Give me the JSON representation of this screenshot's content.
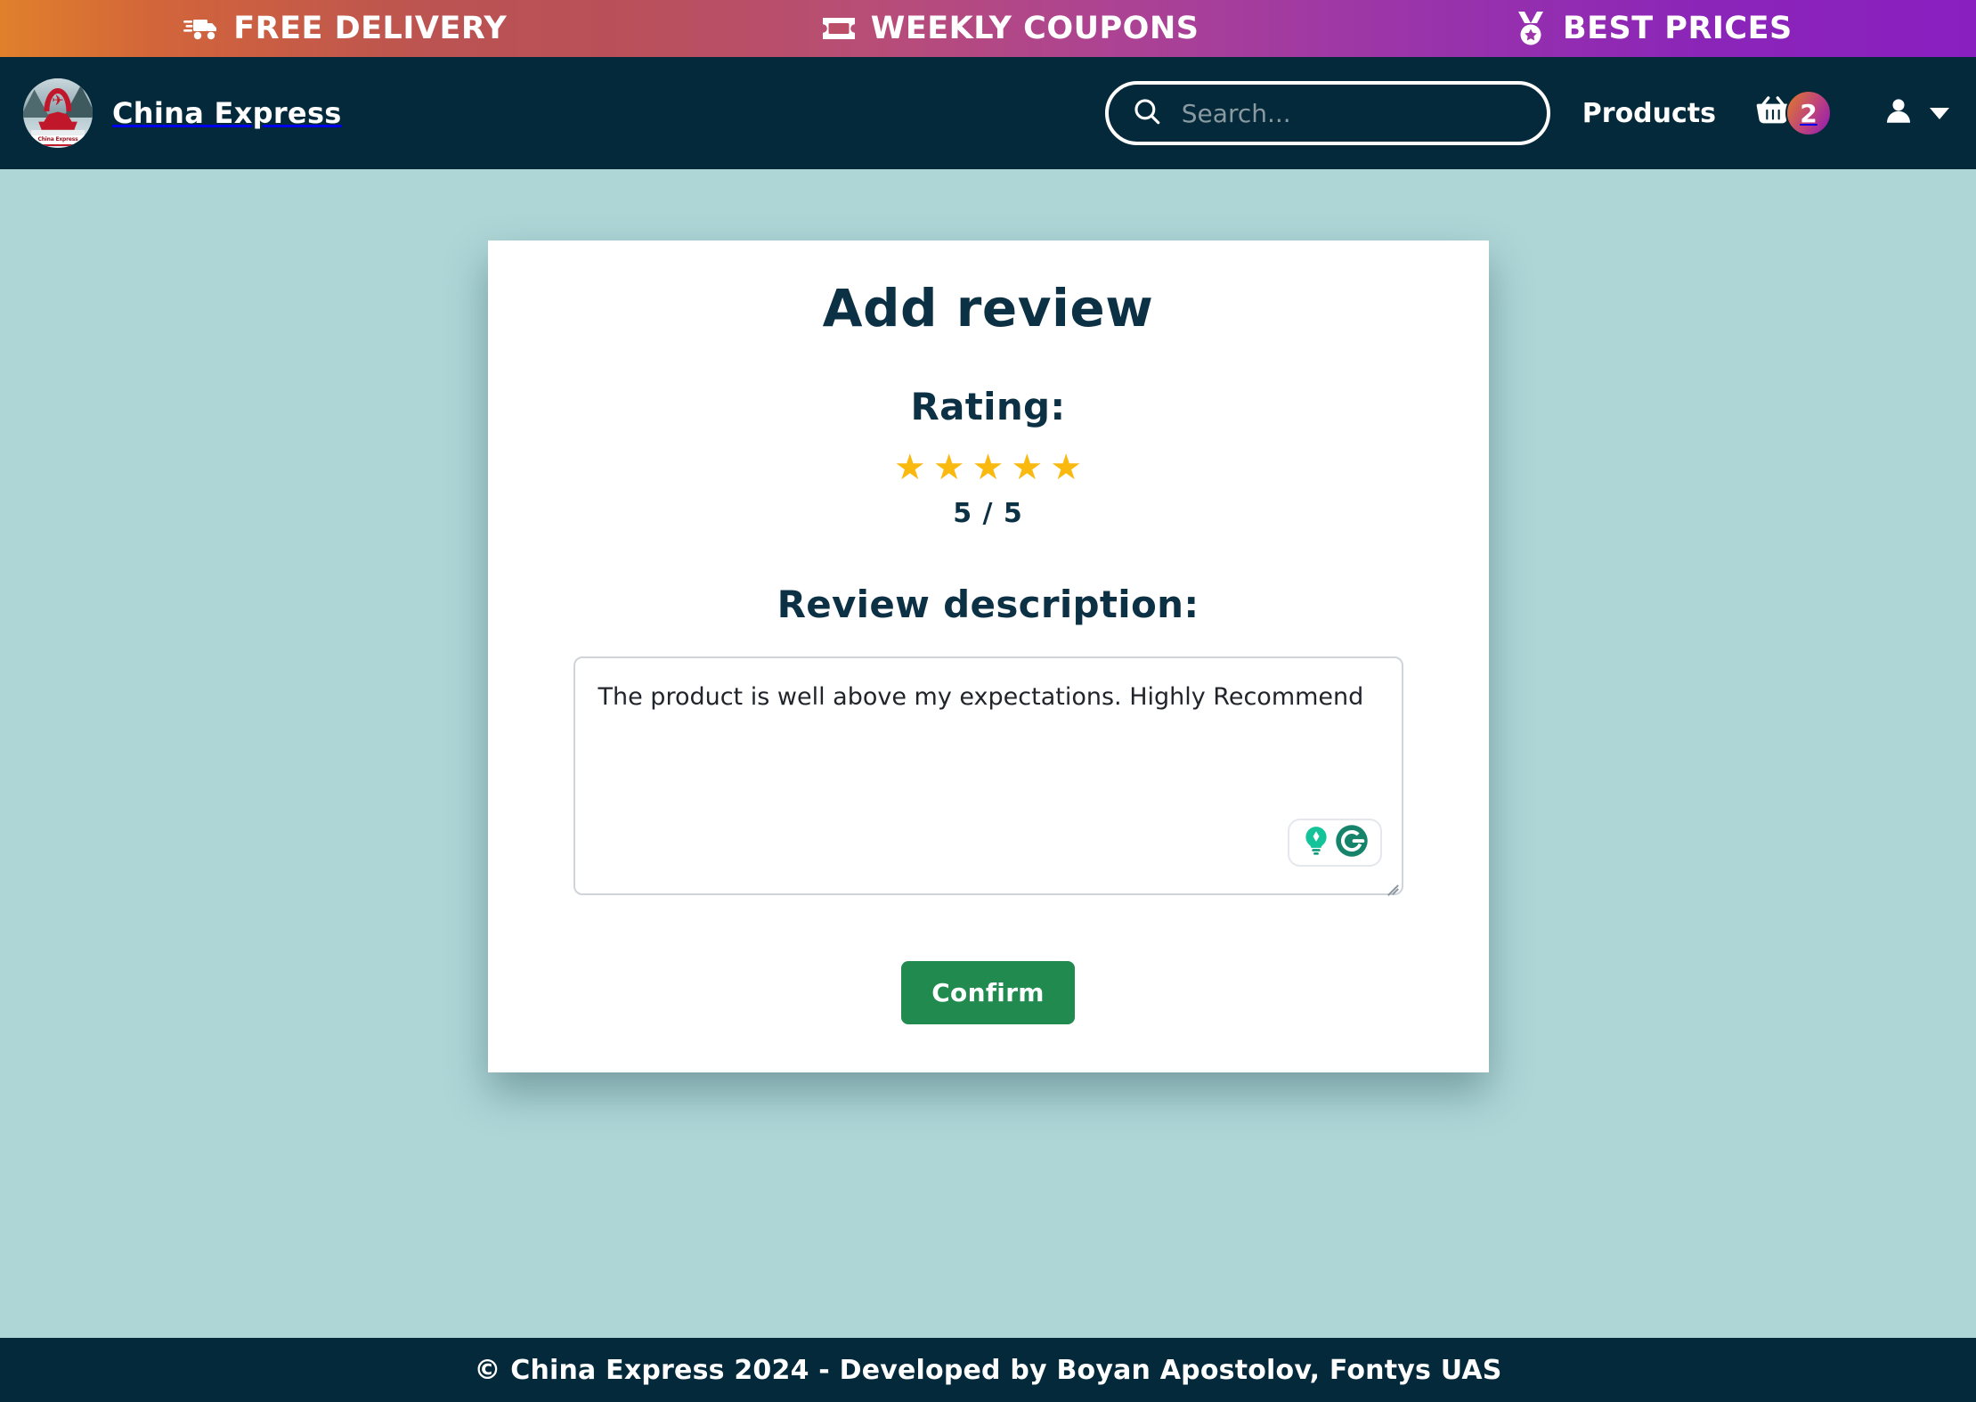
{
  "promo_bar": {
    "items": [
      {
        "icon": "delivery-truck-icon",
        "label": "FREE DELIVERY"
      },
      {
        "icon": "ticket-icon",
        "label": "WEEKLY COUPONS"
      },
      {
        "icon": "medal-icon",
        "label": "BEST PRICES"
      }
    ],
    "gradient_start": "#e0802b",
    "gradient_end": "#8a1fc0"
  },
  "navbar": {
    "logo_alt": "China Express",
    "logo_ribbon_text": "China Express",
    "brand": "China Express",
    "search": {
      "placeholder": "Search...",
      "value": "",
      "icon": "search-icon"
    },
    "products_link": "Products",
    "cart": {
      "icon": "shopping-basket-icon",
      "count": "2"
    },
    "account": {
      "icon": "user-icon",
      "caret": "chevron-down-icon"
    },
    "background_color": "#04293a"
  },
  "page": {
    "background_color": "#aed6d7"
  },
  "card": {
    "title": "Add review",
    "rating": {
      "label": "Rating:",
      "stars_filled": 5,
      "stars_total": 5,
      "star_glyph": "★",
      "star_color": "#f9b90f",
      "value_text": "5 / 5"
    },
    "description": {
      "label": "Review description:",
      "value": "The product is well above my expectations. Highly Recommend",
      "placeholder": ""
    },
    "grammarly": {
      "lightbulb_icon": "lightbulb-icon",
      "logo_icon": "grammarly-logo-icon"
    },
    "confirm_label": "Confirm",
    "confirm_color": "#218a4f"
  },
  "footer": {
    "text": "© China Express 2024 - Developed by Boyan Apostolov, Fontys UAS"
  }
}
